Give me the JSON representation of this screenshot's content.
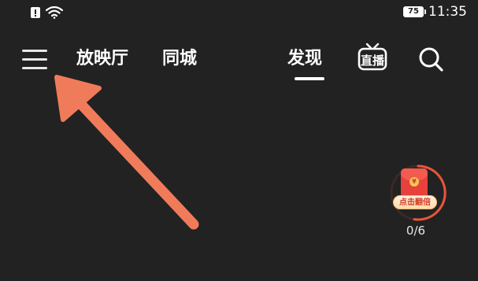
{
  "status_bar": {
    "battery_level": "75",
    "time": "11:35"
  },
  "nav": {
    "tabs": [
      {
        "label": "放映厅"
      },
      {
        "label": "同城"
      },
      {
        "label": "发现"
      }
    ],
    "active_tab": "发现",
    "live_label": "直播"
  },
  "red_packet": {
    "label": "点击翻倍",
    "coin_symbol": "¥",
    "progress": "0/6"
  },
  "colors": {
    "background": "#222222",
    "arrow": "#f07b5a",
    "red_packet": "#e8403a",
    "ring": "#e8563c"
  }
}
